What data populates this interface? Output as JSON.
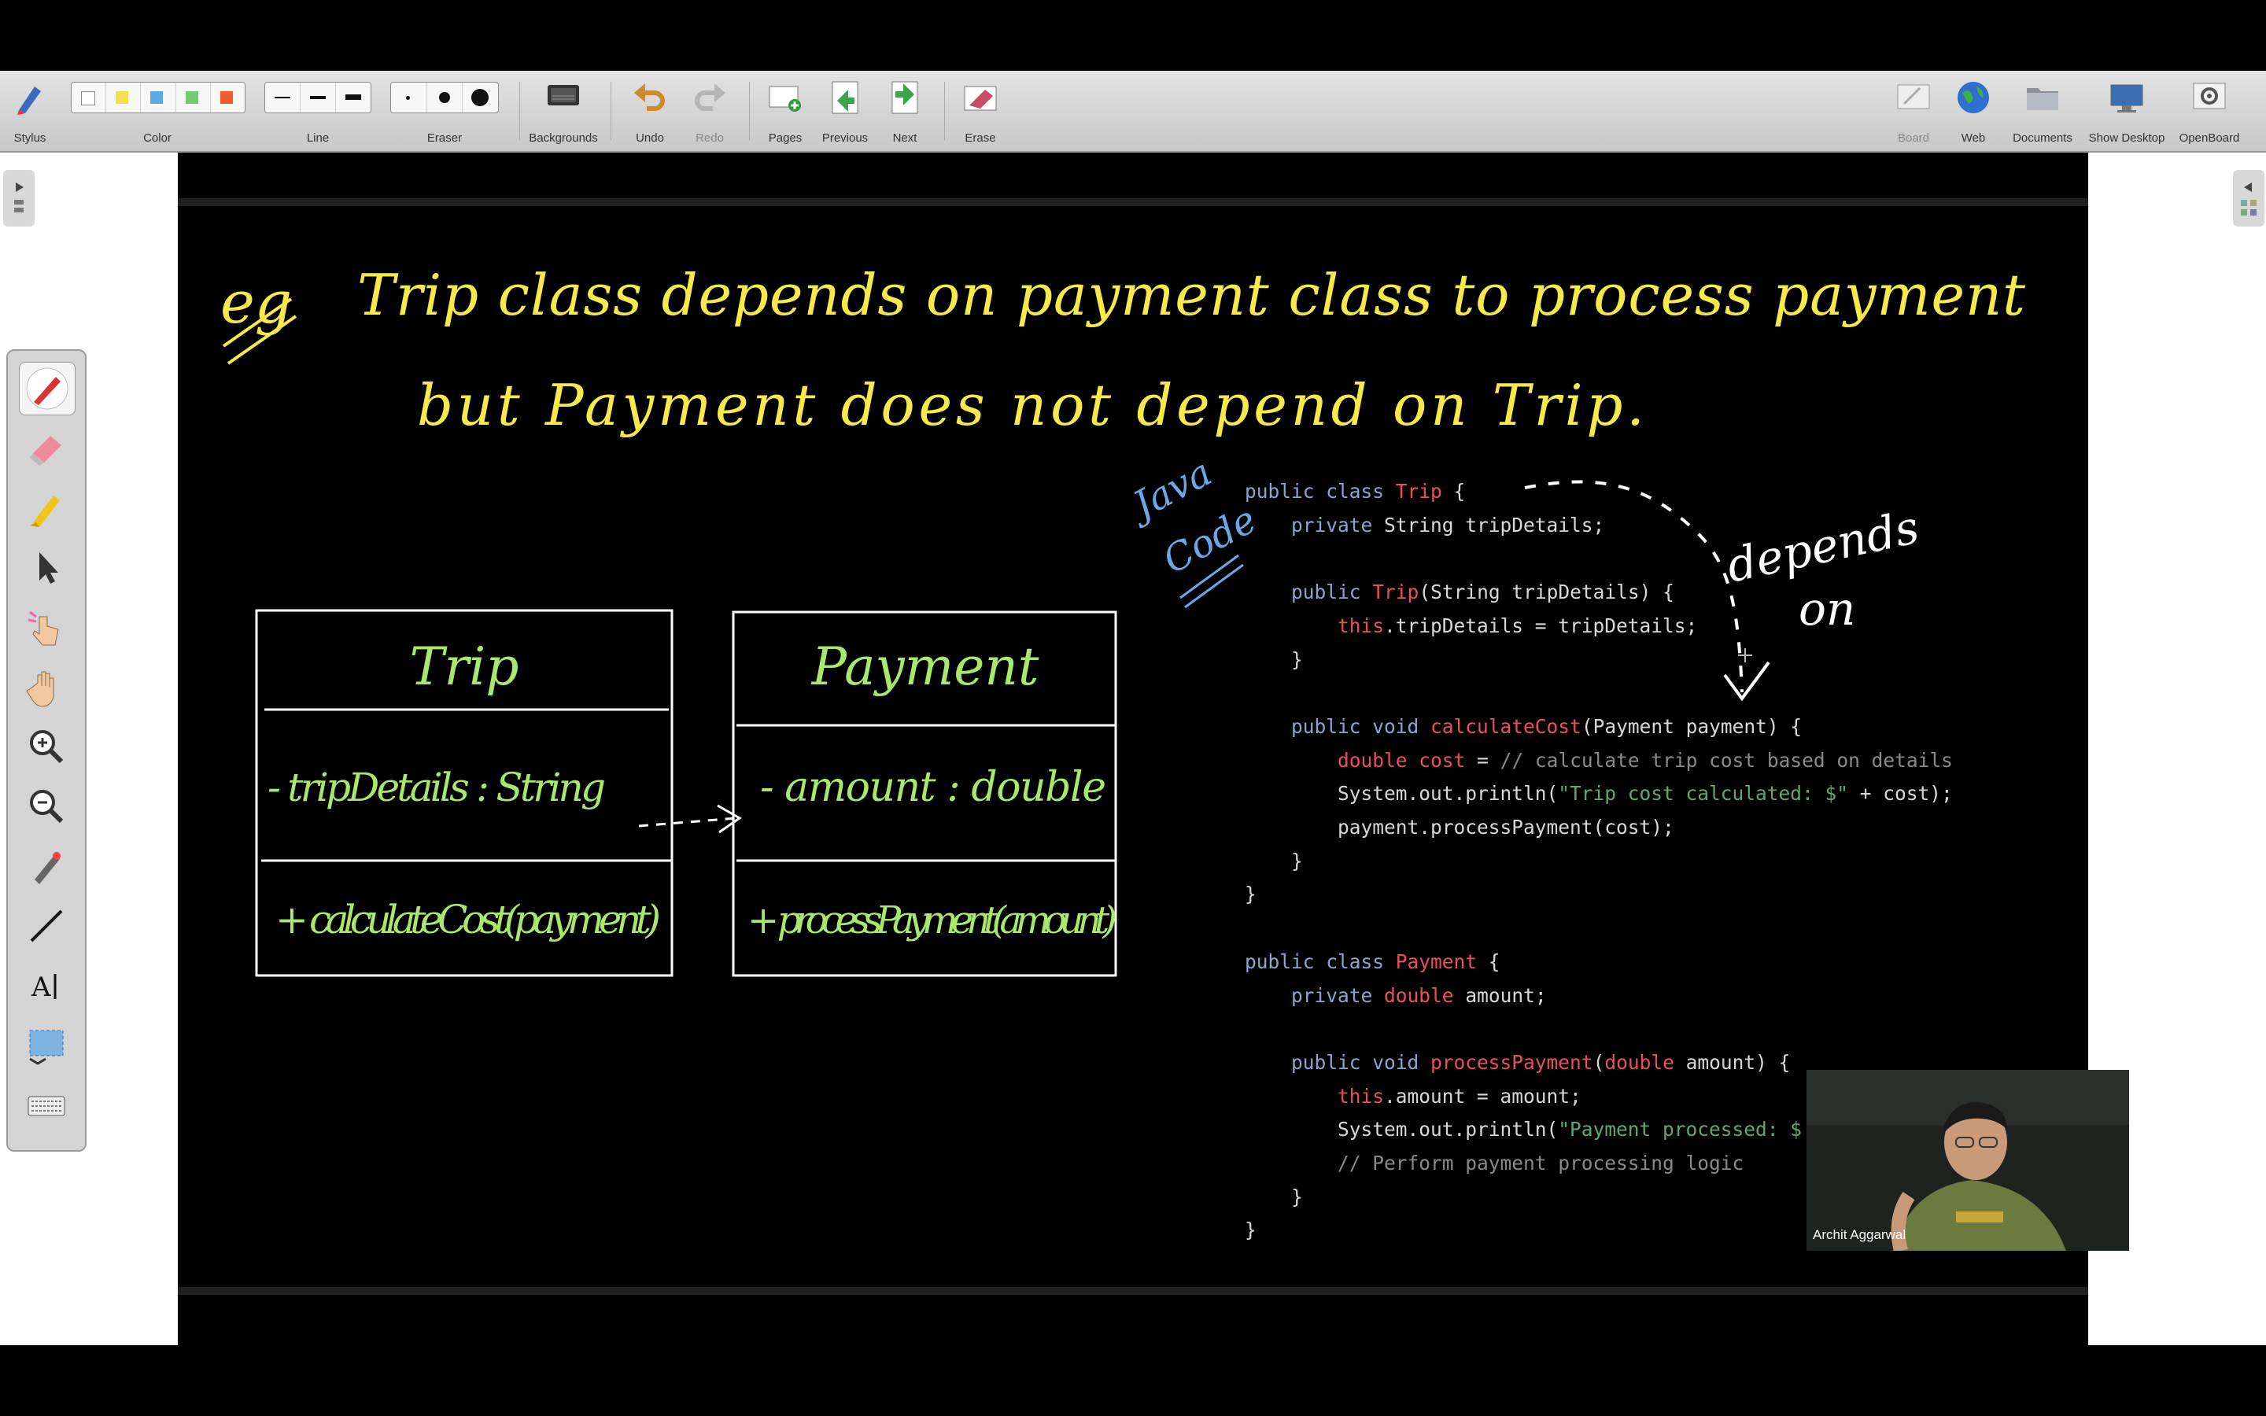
{
  "toolbar": {
    "stylus": "Stylus",
    "color": "Color",
    "line": "Line",
    "eraser": "Eraser",
    "backgrounds": "Backgrounds",
    "undo": "Undo",
    "redo": "Redo",
    "pages": "Pages",
    "previous": "Previous",
    "next": "Next",
    "erase": "Erase",
    "board": "Board",
    "web": "Web",
    "documents": "Documents",
    "show_desktop": "Show Desktop",
    "openboard": "OpenBoard",
    "colors": [
      "#ffffff",
      "#f4e04d",
      "#5aa9e6",
      "#6fcf6f",
      "#f05a28"
    ]
  },
  "handwriting": {
    "line1_eg": "eg",
    "line1": "Trip class depends on payment class to process payment",
    "line2": "but   Payment does not depend on  Trip.",
    "java_code_1": "Java",
    "java_code_2": "Code",
    "depends_1": "depends",
    "depends_2": "on"
  },
  "uml": {
    "trip": {
      "name": "Trip",
      "attribute": "- tripDetails : String",
      "method": "+ calculateCost(payment)"
    },
    "payment": {
      "name": "Payment",
      "attribute": "- amount : double",
      "method": "+ processPayment(amount)"
    }
  },
  "colors": {
    "yellow_ink": "#f5ea4a",
    "green_ink": "#a9e86b",
    "blue_ink": "#6aa8e8",
    "white_ink": "#ffffff"
  },
  "webcam": {
    "name": "Archit Aggarwal"
  }
}
